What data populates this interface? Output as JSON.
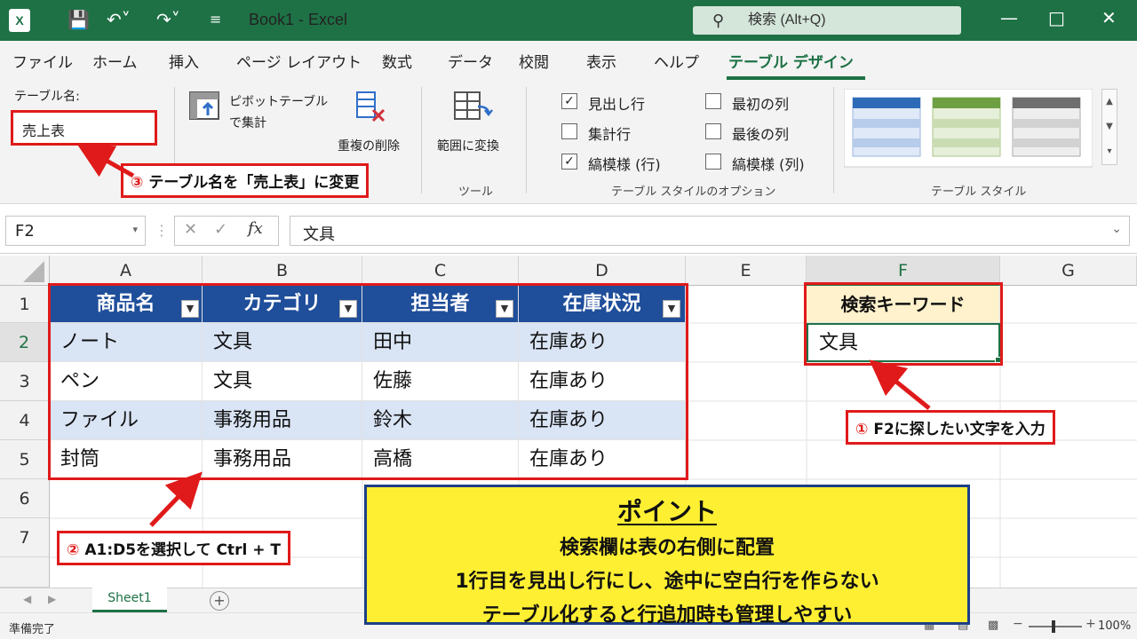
{
  "titlebar": {
    "logo": "X",
    "save_icon": "save-icon",
    "undo_icon": "undo-icon",
    "redo_icon": "redo-icon",
    "title": "Book1  -  Excel",
    "search_placeholder": "検索 (Alt+Q)",
    "accent": "#1e7145"
  },
  "menu": {
    "tabs": [
      "ファイル",
      "ホーム",
      "挿入",
      "ページ レイアウト",
      "数式",
      "データ",
      "校閲",
      "表示",
      "ヘルプ",
      "テーブル デザイン"
    ],
    "active": "テーブル デザイン"
  },
  "ribbon": {
    "table_name_label": "テーブル名:",
    "table_name_value": "売上表",
    "pivot_line1": "ピボットテーブル",
    "pivot_line2": "で集計",
    "remove_dup": "重複の削除",
    "convert_range": "範囲に変換",
    "tools_group": "ツール",
    "options": {
      "header_row": "見出し行",
      "total_row": "集計行",
      "banded_rows": "縞模様 (行)",
      "first_col": "最初の列",
      "last_col": "最後の列",
      "banded_cols": "縞模様 (列)"
    },
    "checked": {
      "header_row": true,
      "total_row": false,
      "banded_rows": true,
      "first_col": false,
      "last_col": false,
      "banded_cols": false
    },
    "options_group": "テーブル スタイルのオプション",
    "styles_group": "テーブル スタイル"
  },
  "formula_bar": {
    "name_box": "F2",
    "fx": "fx",
    "formula": "文具"
  },
  "sheet": {
    "columns": [
      "A",
      "B",
      "C",
      "D",
      "E",
      "F",
      "G"
    ],
    "rows": [
      "1",
      "2",
      "3",
      "4",
      "5",
      "6",
      "7"
    ],
    "table_headers": [
      "商品名",
      "カテゴリ",
      "担当者",
      "在庫状況"
    ],
    "table_rows": [
      [
        "ノート",
        "文具",
        "田中",
        "在庫あり"
      ],
      [
        "ペン",
        "文具",
        "佐藤",
        "在庫あり"
      ],
      [
        "ファイル",
        "事務用品",
        "鈴木",
        "在庫あり"
      ],
      [
        "封筒",
        "事務用品",
        "高橋",
        "在庫あり"
      ]
    ],
    "search_label": "検索キーワード",
    "search_value": "文具",
    "header_color": "#1f4e9a",
    "band_color": "#d9e4f5"
  },
  "callouts": {
    "c1_num": "①",
    "c1_text": "F2に探したい文字を入力",
    "c2_num": "②",
    "c2_text": "A1:D5を選択して Ctrl + T",
    "c3_num": "③",
    "c3_text": "テーブル名を「売上表」に変更",
    "color": "#e01a1a"
  },
  "point_box": {
    "title": "ポイント",
    "lines": [
      "検索欄は表の右側に配置",
      "1行目を見出し行にし、途中に空白行を作らない",
      "テーブル化すると行追加時も管理しやすい"
    ]
  },
  "sheet_tabs": {
    "active": "Sheet1",
    "add": "+"
  },
  "status": {
    "ready": "準備完了",
    "zoom": "100%"
  }
}
